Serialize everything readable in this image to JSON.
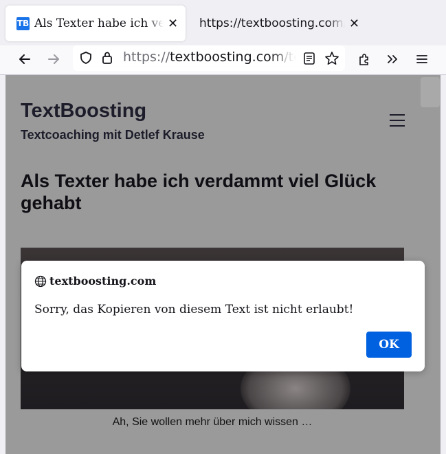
{
  "tabs": [
    {
      "favicon": "TB",
      "title": "Als Texter habe ich verdammt viel Glück gehabt",
      "active": true
    },
    {
      "title": "https://textboosting.com/kontakt",
      "active": false
    }
  ],
  "urlbar": {
    "scheme": "https://",
    "host": "textboosting.com",
    "path": "/texter"
  },
  "page": {
    "site_title": "TextBoosting",
    "site_tagline": "Textcoaching mit Detlef Krause",
    "post_title": "Als Texter habe ich verdammt viel Glück gehabt",
    "caption": "Ah, Sie wollen mehr über mich wissen …"
  },
  "dialog": {
    "origin": "textboosting.com",
    "message": "Sorry, das Kopieren von diesem Text ist nicht erlaubt!",
    "ok_label": "OK"
  },
  "icons": [
    "back-arrow-icon",
    "forward-arrow-icon",
    "shield-icon",
    "lock-icon",
    "reader-view-icon",
    "star-icon",
    "extensions-icon",
    "overflow-chevrons-icon",
    "hamburger-menu-icon",
    "close-icon",
    "globe-icon"
  ],
  "colors": {
    "accent": "#0061e0",
    "dim_overlay": "#9a9a9a"
  }
}
